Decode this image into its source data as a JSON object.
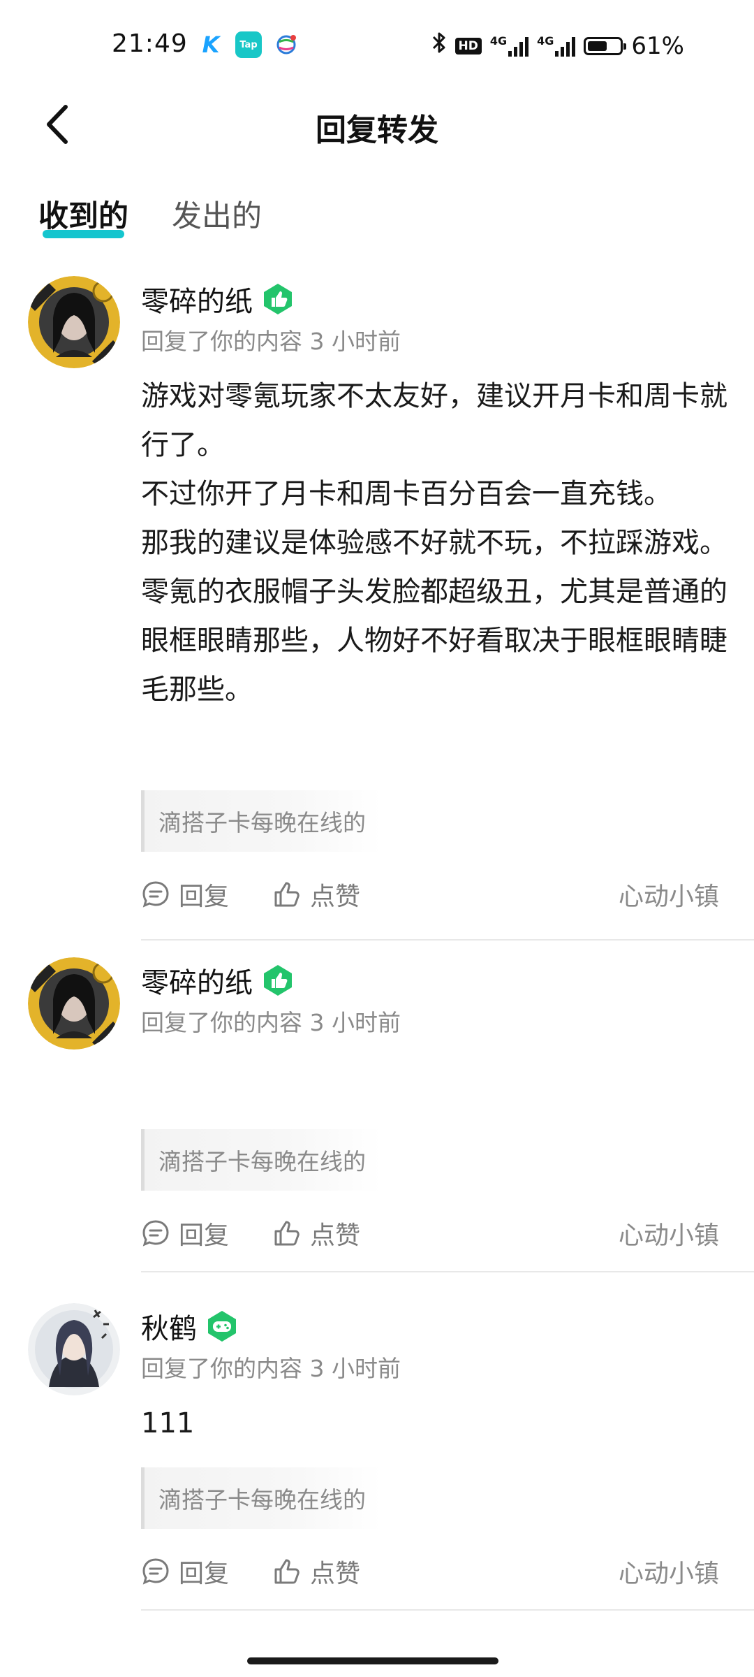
{
  "status_bar": {
    "time": "21:49",
    "notification_icons": [
      "k-app-icon",
      "taptap-icon",
      "mobile-network-icon"
    ],
    "taptap_label": "Tap",
    "hd_label": "HD",
    "network_1": "4G",
    "network_2": "4G",
    "battery_percent": "61%",
    "battery_level": 0.61
  },
  "header": {
    "back_icon": "chevron-left-icon",
    "title": "回复转发"
  },
  "tabs": [
    {
      "label": "收到的",
      "active": true
    },
    {
      "label": "发出的",
      "active": false
    }
  ],
  "colors": {
    "accent": "#15c5ce",
    "badge_green": "#23c46b",
    "muted_text": "#8a8a8a",
    "divider": "#e8e8e8"
  },
  "messages": [
    {
      "user_name": "零碎的纸",
      "badge_icon": "thumbs-up-badge-icon",
      "meta": "回复了你的内容 3 小时前",
      "text": "游戏对零氪玩家不太友好，建议开月卡和周卡就行了。\n不过你开了月卡和周卡百分百会一直充钱。\n那我的建议是体验感不好就不玩，不拉踩游戏。\n零氪的衣服帽子头发脸都超级丑，尤其是普通的眼框眼睛那些，人物好不好看取决于眼框眼睛睫毛那些。",
      "quote": "滴搭子卡每晚在线的",
      "reply_label": "回复",
      "like_label": "点赞",
      "source": "心动小镇"
    },
    {
      "user_name": "零碎的纸",
      "badge_icon": "thumbs-up-badge-icon",
      "meta": "回复了你的内容 3 小时前",
      "text": "",
      "quote": "滴搭子卡每晚在线的",
      "reply_label": "回复",
      "like_label": "点赞",
      "source": "心动小镇"
    },
    {
      "user_name": "秋鹤",
      "badge_icon": "gamepad-badge-icon",
      "meta": "回复了你的内容 3 小时前",
      "text": "111",
      "quote": "滴搭子卡每晚在线的",
      "reply_label": "回复",
      "like_label": "点赞",
      "source": "心动小镇"
    }
  ]
}
